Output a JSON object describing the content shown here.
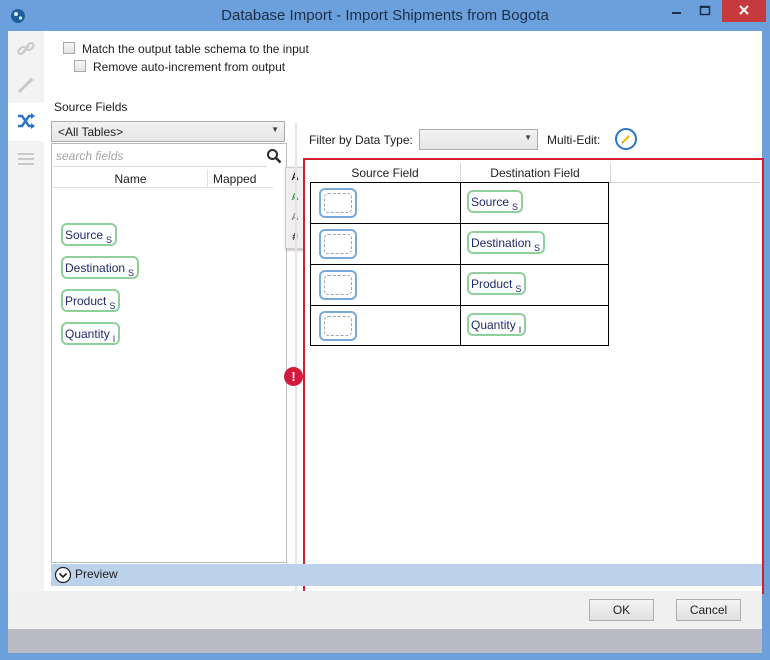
{
  "window": {
    "title": "Database Import - Import Shipments from Bogota",
    "controls": {
      "minimize_icon": "minimize-icon",
      "maximize_icon": "maximize-icon",
      "close_icon": "close-icon"
    },
    "app_icon": "database-icon"
  },
  "nav": {
    "items": [
      {
        "name": "link",
        "icon": "link-icon",
        "active": false
      },
      {
        "name": "transform",
        "icon": "wand-icon",
        "active": false
      },
      {
        "name": "mapping",
        "icon": "shuffle-icon",
        "active": true
      },
      {
        "name": "list",
        "icon": "list-icon",
        "active": false
      }
    ]
  },
  "options": {
    "match_schema_label": "Match the output table schema to the input",
    "match_schema_checked": false,
    "remove_autoinc_label": "Remove auto-increment from output",
    "remove_autoinc_checked": false
  },
  "source_panel": {
    "title": "Source Fields",
    "table_select_value": "<All Tables>",
    "search_placeholder": "search fields",
    "columns": {
      "name": "Name",
      "mapped": "Mapped"
    },
    "fields": [
      {
        "name": "Source",
        "type": "S"
      },
      {
        "name": "Destination",
        "type": "S"
      },
      {
        "name": "Product",
        "type": "S"
      },
      {
        "name": "Quantity",
        "type": "I"
      }
    ],
    "type_toolbar": [
      "A",
      "A",
      "A",
      "#"
    ]
  },
  "mapping": {
    "filter_label": "Filter by Data Type:",
    "filter_value": "",
    "multi_edit_label": "Multi-Edit:",
    "columns": {
      "source": "Source Field",
      "destination": "Destination Field"
    },
    "rows": [
      {
        "destination": "Source",
        "type": "S"
      },
      {
        "destination": "Destination",
        "type": "S"
      },
      {
        "destination": "Product",
        "type": "S"
      },
      {
        "destination": "Quantity",
        "type": "I"
      }
    ],
    "error_indicator": "!"
  },
  "preview": {
    "label": "Preview",
    "icon": "chevron-down-circle-icon"
  },
  "buttons": {
    "ok": "OK",
    "cancel": "Cancel"
  },
  "colors": {
    "title_bar": "#6ca0dc",
    "close_button": "#c6393d",
    "mapping_border": "#d41e2c",
    "field_chip_border": "#8fd19a",
    "accent_blue": "#2d74c7",
    "error_red": "#d4193a"
  }
}
